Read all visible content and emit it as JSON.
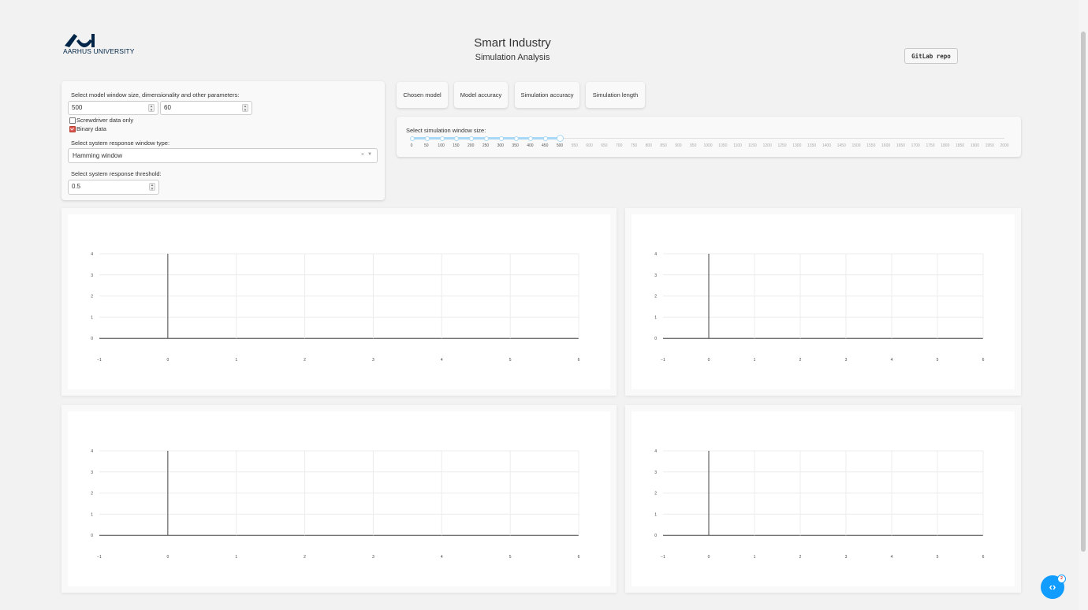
{
  "header": {
    "logo_text": "AARHUS UNIVERSITY",
    "title": "Smart Industry",
    "subtitle": "Simulation Analysis",
    "gitlab_label": "GitLab repo"
  },
  "controls": {
    "params_label": "Select model window size, dimensionality and other parameters:",
    "window_size": "500",
    "dimensionality": "60",
    "screwdriver_label": "Screwdriver data only",
    "screwdriver_checked": false,
    "binary_label": "Binary data",
    "binary_checked": true,
    "response_type_label": "Select system response window type:",
    "response_type_value": "Hamming window",
    "clear_symbol": "×",
    "threshold_label": "Select system response threshold:",
    "threshold_value": "0.5"
  },
  "tabs": [
    {
      "label": "Chosen model"
    },
    {
      "label": "Model accuracy"
    },
    {
      "label": "Simulation accuracy"
    },
    {
      "label": "Simulation length"
    }
  ],
  "slider": {
    "label": "Select simulation window size:",
    "marks": [
      "0",
      "50",
      "100",
      "150",
      "200",
      "250",
      "300",
      "350",
      "400",
      "450",
      "500",
      "550",
      "600",
      "650",
      "700",
      "750",
      "800",
      "850",
      "900",
      "950",
      "1000",
      "1050",
      "1100",
      "1150",
      "1200",
      "1250",
      "1300",
      "1350",
      "1400",
      "1450",
      "1500",
      "1550",
      "1600",
      "1650",
      "1700",
      "1750",
      "1800",
      "1850",
      "1900",
      "1950",
      "2000"
    ],
    "value": 500,
    "min": 0,
    "max": 2000
  },
  "graph_axes": {
    "y_ticks": [
      "4",
      "3",
      "2",
      "1",
      "0",
      "−1"
    ],
    "x_ticks": [
      "−1",
      "0",
      "1",
      "2",
      "3",
      "4",
      "5",
      "6"
    ]
  },
  "fab": {
    "badge": "2"
  },
  "colors": {
    "accent": "#119dff",
    "slider": "#a8d8f5",
    "checkbox": "#d9534f",
    "brand": "#002546"
  }
}
